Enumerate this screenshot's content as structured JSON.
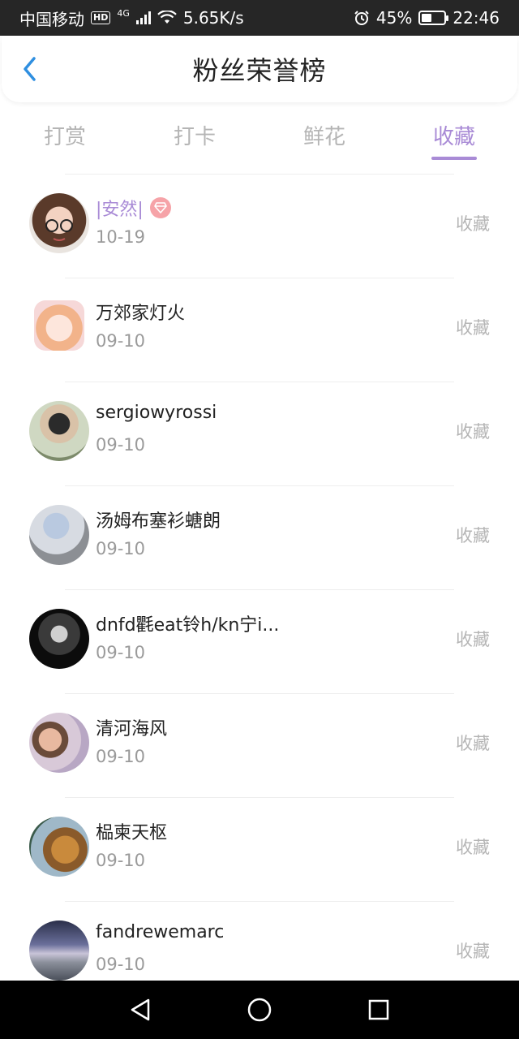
{
  "status_bar": {
    "carrier": "中国移动",
    "hd": "HD",
    "network": "4G",
    "speed": "5.65K/s",
    "battery_percent": "45%",
    "battery_level": 0.45,
    "time": "22:46"
  },
  "header": {
    "title": "粉丝荣誉榜",
    "back_icon": "chevron-left-icon"
  },
  "tabs": [
    {
      "label": "打赏",
      "active": false
    },
    {
      "label": "打卡",
      "active": false
    },
    {
      "label": "鲜花",
      "active": false
    },
    {
      "label": "收藏",
      "active": true
    }
  ],
  "colors": {
    "accent": "#a98bd6",
    "muted": "#b5b5b5",
    "badge": "#f6a3a8"
  },
  "list": [
    {
      "name": "|安然|",
      "date": "10-19",
      "action": "收藏",
      "highlight": true,
      "badge": "diamond-icon"
    },
    {
      "name": "万郊家灯火",
      "date": "09-10",
      "action": "收藏"
    },
    {
      "name": "sergiowyrossi",
      "date": "09-10",
      "action": "收藏"
    },
    {
      "name": "汤姆布塞衫螗朗",
      "date": "09-10",
      "action": "收藏"
    },
    {
      "name": "dnfd氍eat铃h/kn宁i...",
      "date": "09-10",
      "action": "收藏"
    },
    {
      "name": "清河海风",
      "date": "09-10",
      "action": "收藏"
    },
    {
      "name": "榀柬天枢",
      "date": "09-10",
      "action": "收藏"
    },
    {
      "name": "fandrewemarc",
      "date": "09-10",
      "action": "收藏"
    }
  ],
  "nav_bar": {
    "back": "triangle-back-icon",
    "home": "circle-home-icon",
    "recents": "square-recents-icon"
  }
}
